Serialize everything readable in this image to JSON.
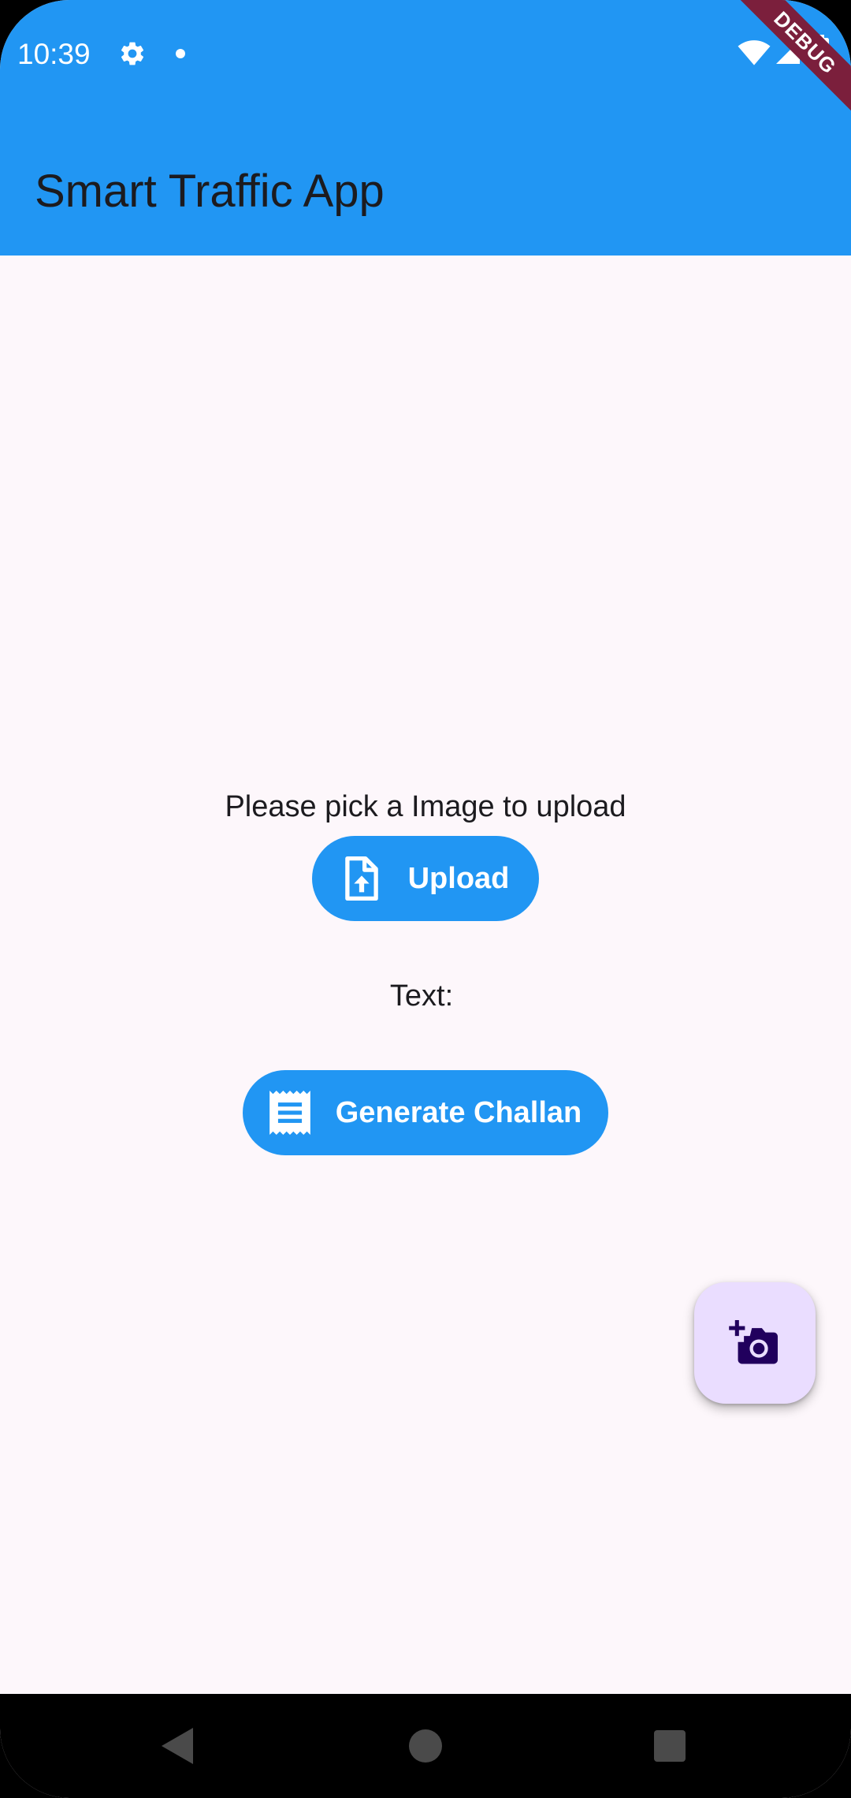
{
  "status_bar": {
    "time": "10:39",
    "icons": [
      "settings-icon",
      "notification-dot-icon",
      "wifi-icon",
      "signal-icon",
      "battery-icon"
    ]
  },
  "debug_banner": {
    "label": "DEBUG"
  },
  "app_bar": {
    "title": "Smart Traffic App"
  },
  "main": {
    "prompt": "Please pick a Image to upload",
    "upload_button": {
      "label": "Upload",
      "icon": "upload-file-icon"
    },
    "text_label": "Text:",
    "generate_button": {
      "label": "Generate Challan",
      "icon": "receipt-icon"
    }
  },
  "fab": {
    "icon": "add-camera-icon"
  },
  "nav_bar": {
    "buttons": [
      "back-icon",
      "home-icon",
      "recents-icon"
    ]
  },
  "colors": {
    "primary": "#2196f3",
    "background": "#fdf7fb",
    "fab_background": "#eaddff",
    "fab_icon": "#21005d",
    "debug_banner": "#7b1f3c"
  }
}
